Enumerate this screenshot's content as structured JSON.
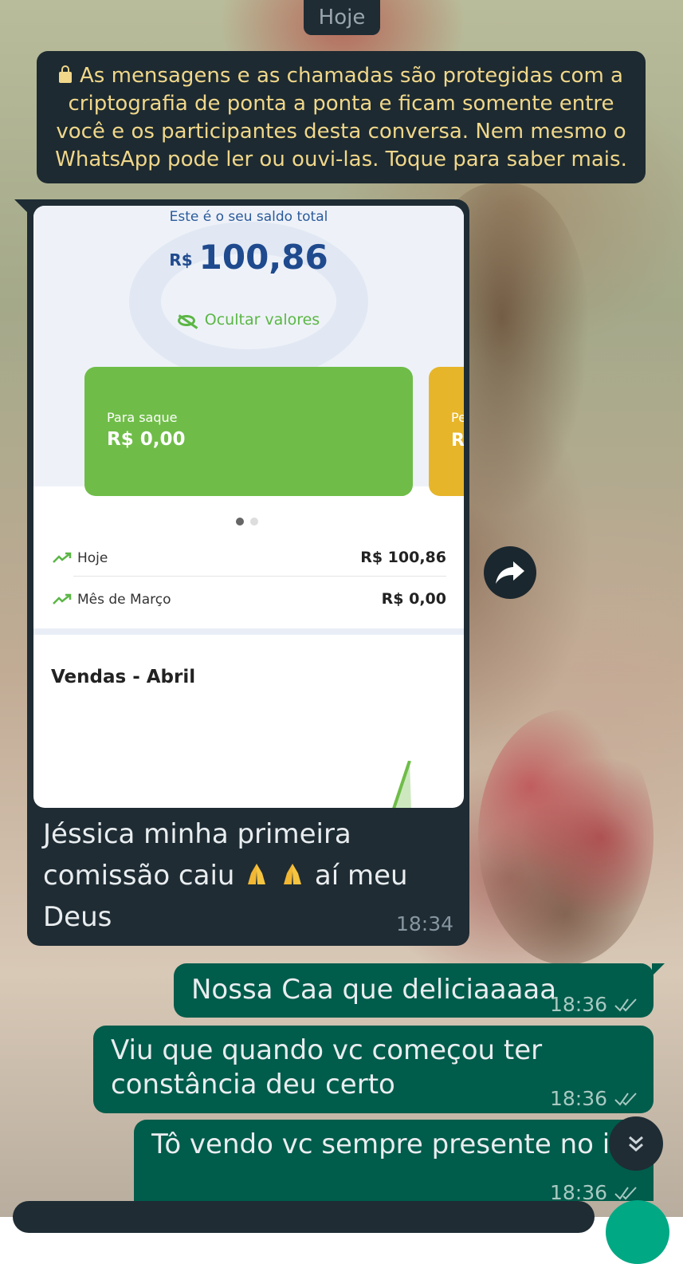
{
  "date_chip": "Hoje",
  "encryption_notice": "As mensagens e as chamadas são protegidas com a criptografia de ponta a ponta e ficam somente entre você e os participantes desta conversa. Nem mesmo o WhatsApp pode ler ou ouvi-las. Toque para saber mais.",
  "incoming": {
    "screenshot": {
      "saldo_label": "Este é o seu saldo total",
      "currency": "R$",
      "saldo_value": "100,86",
      "hide_values": "Ocultar valores",
      "card_primary": {
        "label": "Para saque",
        "value": "R$ 0,00"
      },
      "card_secondary": {
        "label": "Pe",
        "value": "R"
      },
      "rows": [
        {
          "label": "Hoje",
          "amount": "R$ 100,86"
        },
        {
          "label": "Mês de Março",
          "amount": "R$ 0,00"
        }
      ],
      "chart_title": "Vendas - Abril",
      "colors": {
        "green": "#6fbd48",
        "yellow": "#e7b52a",
        "blue": "#1f4a8e"
      }
    },
    "text_line1": "Jéssica minha primeira",
    "text_line2a": "comissão caiu",
    "text_line2b": "aí meu",
    "text_line3": "Deus",
    "emoji": "folded-hands-icon",
    "time": "18:34"
  },
  "outgoing": [
    {
      "text": "Nossa Caa que deliciaaaaa",
      "time": "18:36"
    },
    {
      "line1": "Viu que quando vc começou ter",
      "line2": "constância deu certo",
      "time": "18:36"
    },
    {
      "text": "Tô vendo vc sempre presente no ins",
      "time": "18:36"
    }
  ]
}
